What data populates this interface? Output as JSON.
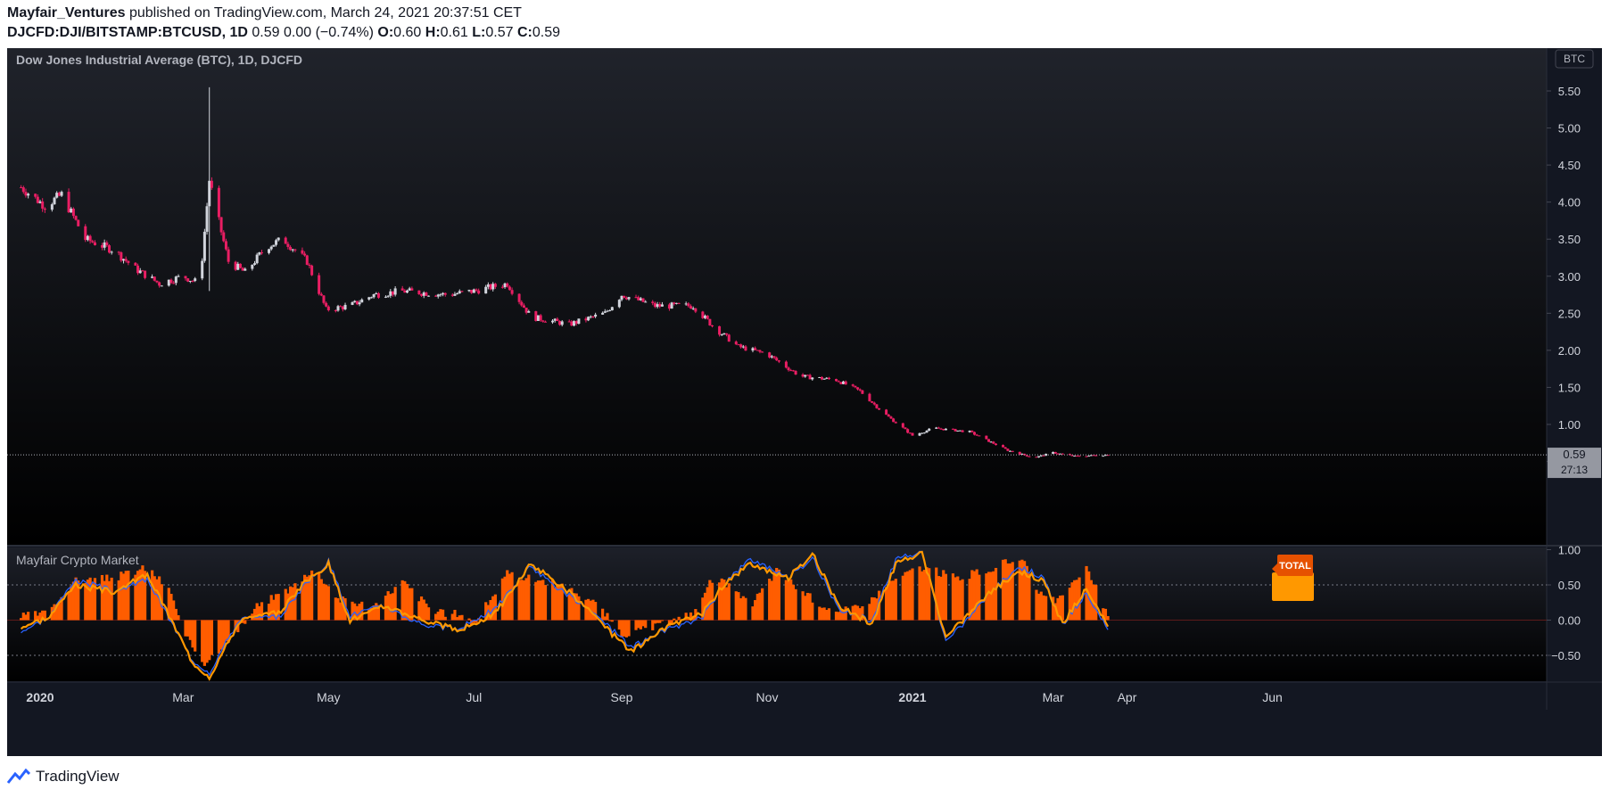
{
  "header": {
    "author": "Mayfair_Ventures",
    "published_text": "published on TradingView.com, March 24, 2021 20:37:51 CET",
    "symbol": "DJCFD:DJI/BITSTAMP:BTCUSD,",
    "interval": "1D",
    "last_change": "0.59 0.00 (−0.74%)",
    "o_label": "O:",
    "o_value": "0.60",
    "h_label": "H:",
    "h_value": "0.61",
    "l_label": "L:",
    "l_value": "0.57",
    "c_label": "C:",
    "c_value": "0.59"
  },
  "main_pane": {
    "legend": "Dow Jones Industrial Average (BTC), 1D, DJCFD",
    "currency_badge": "BTC",
    "price_label": "0.59",
    "countdown_label": "27:13"
  },
  "indicator_pane": {
    "legend": "Mayfair Crypto Market",
    "total_label": "TOTAL"
  },
  "footer": {
    "brand": "TradingView"
  },
  "colors": {
    "background": "#131722",
    "up_candle": "#d1d4dc",
    "down_candle": "#e91e63",
    "histogram": "#ff5d00",
    "oscillator_line": "#ff9800",
    "blue_line": "#2962ff",
    "axis_text": "#d1d4dc"
  },
  "chart_data": [
    {
      "type": "candlestick",
      "title": "Dow Jones Industrial Average (BTC), 1D, DJCFD",
      "y_axis": {
        "ticks": [
          "5.50",
          "5.00",
          "4.50",
          "4.00",
          "3.50",
          "3.00",
          "2.50",
          "2.00",
          "1.50",
          "1.00",
          "0.50"
        ],
        "range": [
          0.25,
          5.8
        ],
        "position": "right"
      },
      "x_axis": {
        "ticks": [
          {
            "label": "2020",
            "date": "2020-01-01",
            "bold": true
          },
          {
            "label": "Mar",
            "date": "2020-03-01"
          },
          {
            "label": "May",
            "date": "2020-05-01"
          },
          {
            "label": "Jul",
            "date": "2020-07-01"
          },
          {
            "label": "Sep",
            "date": "2020-09-01"
          },
          {
            "label": "Nov",
            "date": "2020-11-01"
          },
          {
            "label": "2021",
            "date": "2021-01-01",
            "bold": true
          },
          {
            "label": "Mar",
            "date": "2021-03-01"
          },
          {
            "label": "Apr",
            "date": "2021-04-01"
          },
          {
            "label": "Jun",
            "date": "2021-06-01"
          }
        ]
      },
      "date_range": [
        "2019-12-24",
        "2021-03-24"
      ],
      "approx_close_path": [
        {
          "date": "2019-12-24",
          "value": 4.2
        },
        {
          "date": "2020-01-03",
          "value": 3.95
        },
        {
          "date": "2020-01-10",
          "value": 4.1
        },
        {
          "date": "2020-01-20",
          "value": 3.5
        },
        {
          "date": "2020-02-01",
          "value": 3.35
        },
        {
          "date": "2020-02-10",
          "value": 3.1
        },
        {
          "date": "2020-02-20",
          "value": 2.9
        },
        {
          "date": "2020-03-01",
          "value": 3.0
        },
        {
          "date": "2020-03-08",
          "value": 2.9
        },
        {
          "date": "2020-03-12",
          "value": 4.3
        },
        {
          "date": "2020-03-14",
          "value": 4.0
        },
        {
          "date": "2020-03-20",
          "value": 3.2
        },
        {
          "date": "2020-03-27",
          "value": 3.05
        },
        {
          "date": "2020-04-05",
          "value": 3.4
        },
        {
          "date": "2020-04-12",
          "value": 3.5
        },
        {
          "date": "2020-04-22",
          "value": 3.2
        },
        {
          "date": "2020-04-30",
          "value": 2.55
        },
        {
          "date": "2020-05-10",
          "value": 2.6
        },
        {
          "date": "2020-05-20",
          "value": 2.75
        },
        {
          "date": "2020-06-01",
          "value": 2.8
        },
        {
          "date": "2020-06-20",
          "value": 2.75
        },
        {
          "date": "2020-07-01",
          "value": 2.8
        },
        {
          "date": "2020-07-15",
          "value": 2.9
        },
        {
          "date": "2020-07-25",
          "value": 2.45
        },
        {
          "date": "2020-08-10",
          "value": 2.35
        },
        {
          "date": "2020-08-25",
          "value": 2.5
        },
        {
          "date": "2020-09-01",
          "value": 2.75
        },
        {
          "date": "2020-09-15",
          "value": 2.6
        },
        {
          "date": "2020-10-01",
          "value": 2.6
        },
        {
          "date": "2020-10-10",
          "value": 2.3
        },
        {
          "date": "2020-10-20",
          "value": 2.05
        },
        {
          "date": "2020-11-01",
          "value": 1.95
        },
        {
          "date": "2020-11-15",
          "value": 1.65
        },
        {
          "date": "2020-11-30",
          "value": 1.6
        },
        {
          "date": "2020-12-10",
          "value": 1.45
        },
        {
          "date": "2020-12-20",
          "value": 1.15
        },
        {
          "date": "2021-01-01",
          "value": 0.85
        },
        {
          "date": "2021-01-10",
          "value": 0.95
        },
        {
          "date": "2021-01-25",
          "value": 0.9
        },
        {
          "date": "2021-02-10",
          "value": 0.65
        },
        {
          "date": "2021-02-21",
          "value": 0.55
        },
        {
          "date": "2021-03-01",
          "value": 0.62
        },
        {
          "date": "2021-03-10",
          "value": 0.57
        },
        {
          "date": "2021-03-24",
          "value": 0.59
        }
      ],
      "spike": {
        "date": "2020-03-12",
        "high": 5.55,
        "low": 2.8
      },
      "last": {
        "open": 0.6,
        "high": 0.61,
        "low": 0.57,
        "close": 0.59
      }
    },
    {
      "type": "histogram",
      "title": "Mayfair Crypto Market",
      "y_axis": {
        "ticks": [
          "1.00",
          "0.50",
          "0.00",
          "−0.50"
        ],
        "range": [
          -0.95,
          1.0
        ],
        "dotted_levels": [
          0.5,
          -0.5
        ]
      },
      "series": [
        {
          "name": "TOTAL",
          "kind": "histogram",
          "approx_path": [
            {
              "date": "2019-12-24",
              "value": 0.05
            },
            {
              "date": "2020-01-05",
              "value": 0.1
            },
            {
              "date": "2020-01-15",
              "value": 0.55
            },
            {
              "date": "2020-02-01",
              "value": 0.6
            },
            {
              "date": "2020-02-15",
              "value": 0.75
            },
            {
              "date": "2020-02-25",
              "value": 0.4
            },
            {
              "date": "2020-03-01",
              "value": -0.2
            },
            {
              "date": "2020-03-10",
              "value": -0.6
            },
            {
              "date": "2020-03-20",
              "value": -0.3
            },
            {
              "date": "2020-04-01",
              "value": 0.2
            },
            {
              "date": "2020-04-15",
              "value": 0.45
            },
            {
              "date": "2020-04-25",
              "value": 0.75
            },
            {
              "date": "2020-05-05",
              "value": 0.3
            },
            {
              "date": "2020-05-20",
              "value": 0.2
            },
            {
              "date": "2020-06-01",
              "value": 0.55
            },
            {
              "date": "2020-06-15",
              "value": 0.1
            },
            {
              "date": "2020-06-25",
              "value": 0.1
            },
            {
              "date": "2020-07-01",
              "value": -0.05
            },
            {
              "date": "2020-07-15",
              "value": 0.65
            },
            {
              "date": "2020-08-01",
              "value": 0.55
            },
            {
              "date": "2020-08-20",
              "value": 0.3
            },
            {
              "date": "2020-09-01",
              "value": -0.2
            },
            {
              "date": "2020-09-15",
              "value": -0.1
            },
            {
              "date": "2020-10-01",
              "value": 0.1
            },
            {
              "date": "2020-10-10",
              "value": 0.65
            },
            {
              "date": "2020-10-25",
              "value": 0.2
            },
            {
              "date": "2020-11-05",
              "value": 0.7
            },
            {
              "date": "2020-11-20",
              "value": 0.3
            },
            {
              "date": "2020-12-01",
              "value": 0.1
            },
            {
              "date": "2020-12-15",
              "value": 0.3
            },
            {
              "date": "2020-12-25",
              "value": 0.6
            },
            {
              "date": "2021-01-05",
              "value": 0.75
            },
            {
              "date": "2021-01-20",
              "value": 0.6
            },
            {
              "date": "2021-02-01",
              "value": 0.7
            },
            {
              "date": "2021-02-15",
              "value": 0.9
            },
            {
              "date": "2021-02-25",
              "value": 0.3
            },
            {
              "date": "2021-03-05",
              "value": 0.3
            },
            {
              "date": "2021-03-15",
              "value": 0.75
            },
            {
              "date": "2021-03-24",
              "value": 0.05
            }
          ]
        },
        {
          "kind": "line",
          "color": "#ff9800",
          "approx_path": [
            {
              "date": "2019-12-24",
              "value": -0.1
            },
            {
              "date": "2020-01-05",
              "value": 0.05
            },
            {
              "date": "2020-01-15",
              "value": 0.5
            },
            {
              "date": "2020-02-01",
              "value": 0.4
            },
            {
              "date": "2020-02-15",
              "value": 0.65
            },
            {
              "date": "2020-02-25",
              "value": 0.0
            },
            {
              "date": "2020-03-05",
              "value": -0.6
            },
            {
              "date": "2020-03-12",
              "value": -0.8
            },
            {
              "date": "2020-03-25",
              "value": 0.0
            },
            {
              "date": "2020-04-10",
              "value": 0.1
            },
            {
              "date": "2020-04-20",
              "value": 0.5
            },
            {
              "date": "2020-05-01",
              "value": 0.8
            },
            {
              "date": "2020-05-10",
              "value": 0.0
            },
            {
              "date": "2020-05-25",
              "value": 0.2
            },
            {
              "date": "2020-06-10",
              "value": 0.0
            },
            {
              "date": "2020-06-25",
              "value": -0.15
            },
            {
              "date": "2020-07-10",
              "value": 0.1
            },
            {
              "date": "2020-07-25",
              "value": 0.8
            },
            {
              "date": "2020-08-10",
              "value": 0.4
            },
            {
              "date": "2020-08-25",
              "value": -0.1
            },
            {
              "date": "2020-09-05",
              "value": -0.45
            },
            {
              "date": "2020-09-20",
              "value": -0.1
            },
            {
              "date": "2020-10-05",
              "value": 0.1
            },
            {
              "date": "2020-10-15",
              "value": 0.55
            },
            {
              "date": "2020-10-25",
              "value": 0.8
            },
            {
              "date": "2020-11-10",
              "value": 0.6
            },
            {
              "date": "2020-11-20",
              "value": 0.95
            },
            {
              "date": "2020-12-01",
              "value": 0.2
            },
            {
              "date": "2020-12-15",
              "value": -0.05
            },
            {
              "date": "2020-12-25",
              "value": 0.8
            },
            {
              "date": "2021-01-05",
              "value": 0.95
            },
            {
              "date": "2021-01-15",
              "value": -0.25
            },
            {
              "date": "2021-02-01",
              "value": 0.35
            },
            {
              "date": "2021-02-15",
              "value": 0.7
            },
            {
              "date": "2021-02-25",
              "value": 0.55
            },
            {
              "date": "2021-03-05",
              "value": -0.05
            },
            {
              "date": "2021-03-15",
              "value": 0.45
            },
            {
              "date": "2021-03-24",
              "value": -0.1
            }
          ]
        }
      ]
    }
  ]
}
